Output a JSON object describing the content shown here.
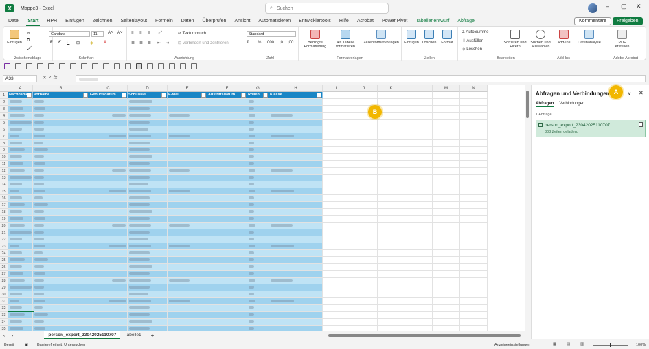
{
  "window": {
    "title": "Mappe3 - Excel",
    "search_placeholder": "Suchen",
    "comments_button": "Kommentare",
    "share_button": "Freigeben"
  },
  "menu_tabs": [
    "Datei",
    "Start",
    "HPH",
    "Einfügen",
    "Zeichnen",
    "Seitenlayout",
    "Formeln",
    "Daten",
    "Überprüfen",
    "Ansicht",
    "Automatisieren",
    "Entwicklertools",
    "Hilfe",
    "Acrobat",
    "Power Pivot",
    "Tabellenentwurf",
    "Abfrage"
  ],
  "active_tab": "Start",
  "ribbon": {
    "clipboard": {
      "paste": "Einfügen",
      "group": "Zwischenablage"
    },
    "font": {
      "name": "Candara",
      "size": "11",
      "group": "Schriftart"
    },
    "alignment": {
      "wrap": "Textumbruch",
      "merge": "Verbinden und zentrieren",
      "group": "Ausrichtung"
    },
    "number": {
      "format": "Standard",
      "group": "Zahl"
    },
    "styles": {
      "conditional": "Bedingte Formatierung",
      "as_table": "Als Tabelle formatieren",
      "cell_styles": "Zellenformatvorlagen",
      "group": "Formatvorlagen"
    },
    "cells": {
      "insert": "Einfügen",
      "delete": "Löschen",
      "format": "Format",
      "group": "Zellen"
    },
    "editing": {
      "autosum": "AutoSumme",
      "fill": "Ausfüllen",
      "clear": "Löschen",
      "sort": "Sortieren und Filtern",
      "find": "Suchen und Auswählen",
      "group": "Bearbeiten"
    },
    "addins": {
      "label": "Add-Ins",
      "group": "Add-Ins"
    },
    "analysis": {
      "label": "Datenanalyse"
    },
    "acrobat": {
      "label": "PDF erstellen",
      "group": "Adobe Acrobat"
    }
  },
  "formula_bar": {
    "name_box": "A33",
    "fx": "fx"
  },
  "columns": [
    "A",
    "B",
    "C",
    "D",
    "E",
    "F",
    "G",
    "H",
    "I",
    "J",
    "K",
    "L",
    "M",
    "N"
  ],
  "table_headers": [
    "Nachname",
    "Vorname",
    "Geburtsdatum",
    "Schlüssel",
    "E-Mail",
    "Austrittsdatum",
    "Rollen",
    "Klasse"
  ],
  "row_numbers": [
    "1",
    "2",
    "3",
    "4",
    "5",
    "6",
    "7",
    "8",
    "9",
    "10",
    "11",
    "12",
    "13",
    "14",
    "15",
    "16",
    "17",
    "18",
    "19",
    "20",
    "21",
    "22",
    "23",
    "24",
    "25",
    "26",
    "27",
    "28",
    "29",
    "30",
    "31",
    "32",
    "33",
    "34",
    "35"
  ],
  "callouts": {
    "a": "A",
    "b": "B"
  },
  "pane": {
    "title": "Abfragen und Verbindungen",
    "tab_queries": "Abfragen",
    "tab_connections": "Verbindungen",
    "count": "1 Abfrage",
    "query_name": "person_export_23042025110707",
    "query_status": "303 Zeilen geladen."
  },
  "sheet_tabs": [
    "person_export_23042025110707",
    "Tabelle1"
  ],
  "status": {
    "ready": "Bereit",
    "accessibility": "Barrierefreiheit: Untersuchen",
    "display_settings": "Anzeigeeinstellungen",
    "zoom": "100%"
  },
  "colors": {
    "excel_green": "#107c41",
    "table_header": "#1a86c5",
    "band_light": "#bfe3f5",
    "band_dark": "#9fd2ee",
    "callout": "#f2b700"
  }
}
